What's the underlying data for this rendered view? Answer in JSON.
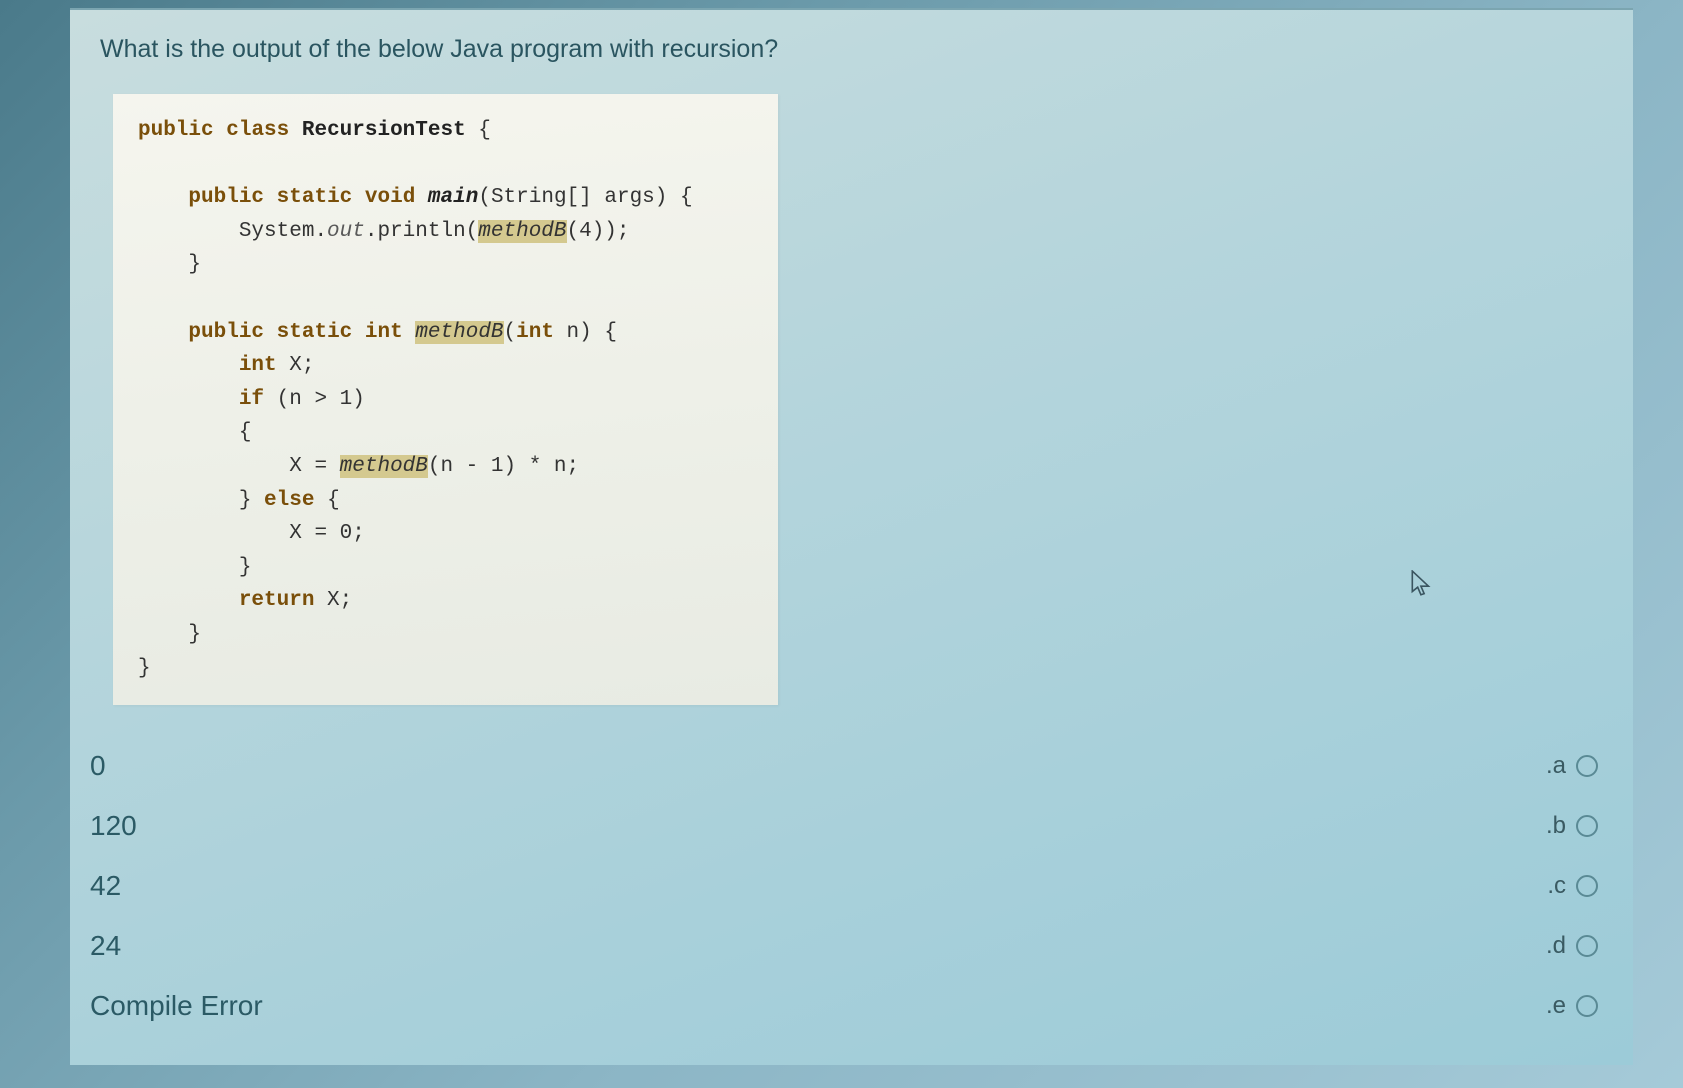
{
  "question": {
    "prompt": "What is the output of the below Java program with recursion?"
  },
  "code": {
    "line1_public": "public",
    "line1_class": "class",
    "line1_name": "RecursionTest",
    "line1_brace": " {",
    "main_public": "public",
    "main_static": "static",
    "main_void": "void",
    "main_name": "main",
    "main_sig": "(String[] args) {",
    "println_start": "System.",
    "println_out": "out",
    "println_mid": ".println(",
    "println_call": "methodB",
    "println_end": "(4));",
    "close_brace": "}",
    "mb_public": "public",
    "mb_static": "static",
    "mb_int": "int",
    "mb_name": "methodB",
    "mb_sig": "(",
    "mb_int2": "int",
    "mb_sig2": " n) {",
    "int_x": "int",
    "int_x2": " X;",
    "if_kw": "if",
    "if_cond": " (n > 1)",
    "open_brace": "{",
    "x_assign": "X = ",
    "x_call": "methodB",
    "x_rest": "(n - 1) * n;",
    "else_close": "} ",
    "else_kw": "else",
    "else_open": " {",
    "x_zero": "X = 0;",
    "return_kw": "return",
    "return_rest": " X;"
  },
  "answers": [
    {
      "text": "0",
      "letter": ".a"
    },
    {
      "text": "120",
      "letter": ".b"
    },
    {
      "text": "42",
      "letter": ".c"
    },
    {
      "text": "24",
      "letter": ".d"
    },
    {
      "text": "Compile Error",
      "letter": ".e"
    }
  ]
}
